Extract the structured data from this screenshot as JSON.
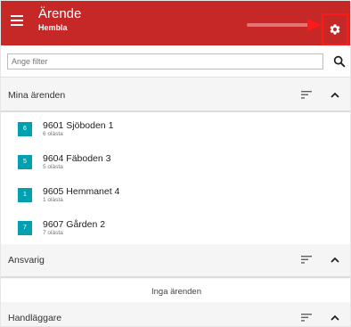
{
  "header": {
    "title": "Ärende",
    "subtitle": "Hembla"
  },
  "filter": {
    "placeholder": "Ange filter"
  },
  "sections": {
    "mina": {
      "title": "Mina ärenden",
      "items": [
        {
          "badge": "6",
          "title": "9601 Sjöboden 1",
          "sub": "6 olästa"
        },
        {
          "badge": "5",
          "title": "9604 Fäboden 3",
          "sub": "5 olästa"
        },
        {
          "badge": "1",
          "title": "9605 Hemmanet 4",
          "sub": "1 olästa"
        },
        {
          "badge": "7",
          "title": "9607 Gården 2",
          "sub": "7 olästa"
        }
      ]
    },
    "ansvarig": {
      "title": "Ansvarig",
      "empty": "Inga ärenden"
    },
    "handlaggare": {
      "title": "Handläggare"
    }
  },
  "colors": {
    "header": "#c62828",
    "badge": "#00a0b0",
    "highlight": "#ff1a1a"
  }
}
